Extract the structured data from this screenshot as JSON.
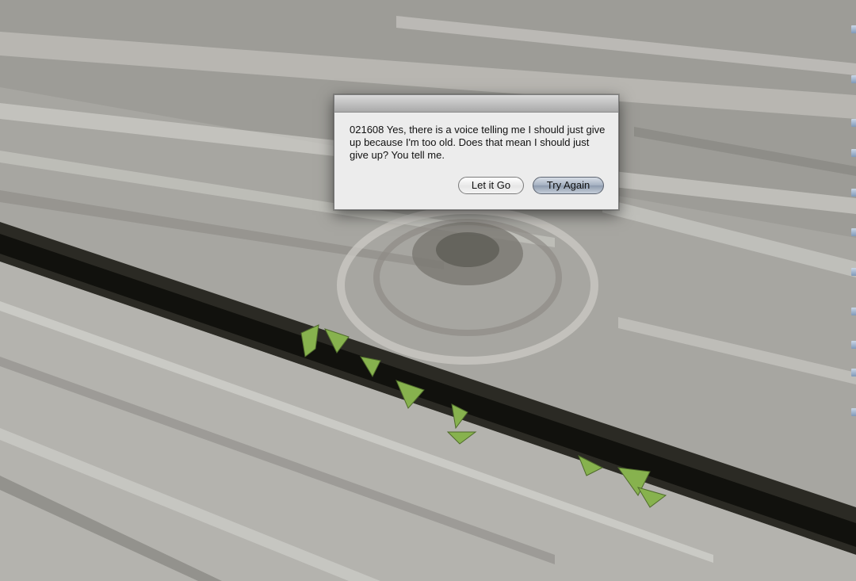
{
  "dialog": {
    "message": "021608   Yes, there is a voice telling me I should just give up because I'm too old. Does that mean I should just give up? You tell me.",
    "buttons": {
      "secondary_label": "Let it Go",
      "default_label": "Try Again"
    }
  },
  "wallpaper": {
    "icon": "weathered-wood-deck-wallpaper",
    "colors": {
      "wood": "#a9a8a3",
      "wood_light": "#d9d9d6",
      "crack": "#14140f",
      "leaf": "#7fae4a"
    }
  },
  "colors": {
    "dialog_bg": "#ececec",
    "default_button": "#9aa7b9"
  }
}
